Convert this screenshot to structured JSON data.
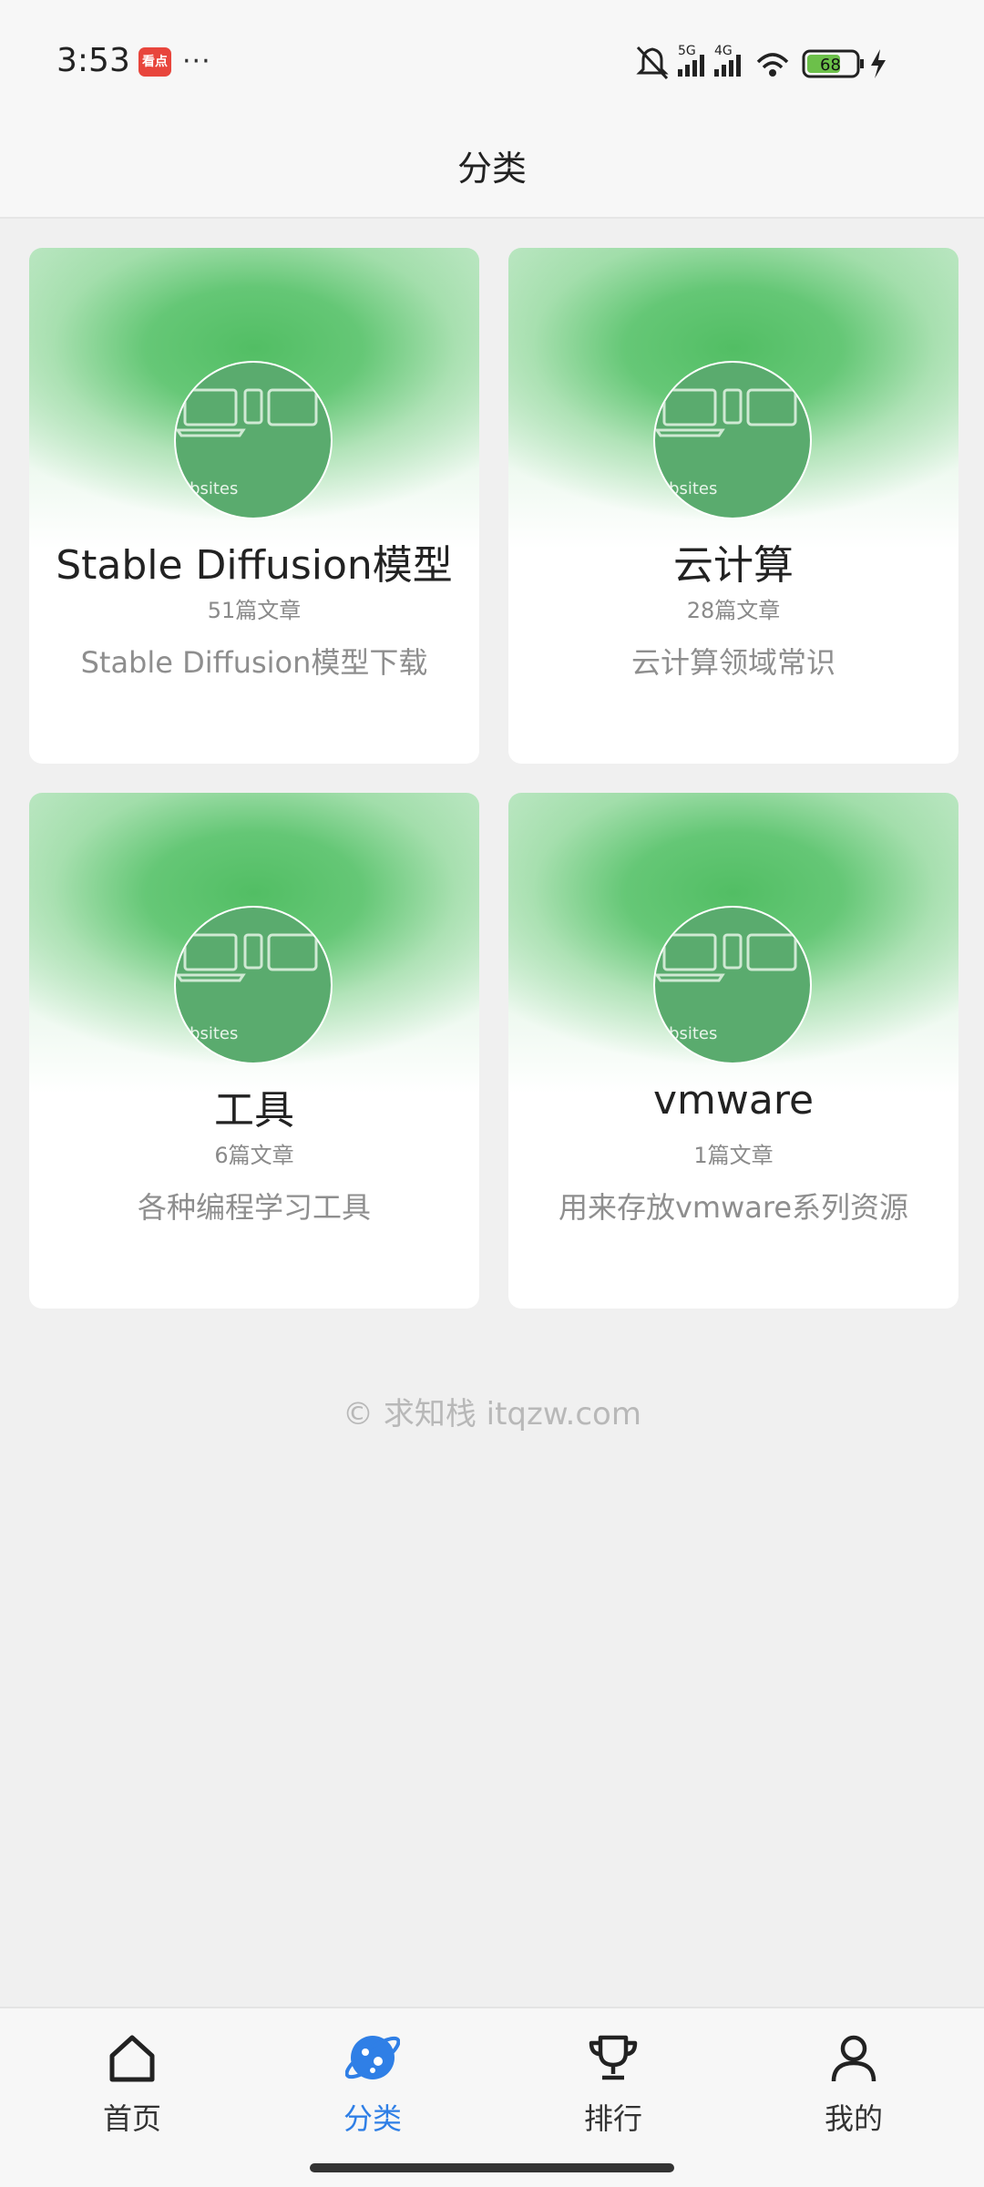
{
  "status_bar": {
    "time": "3:53",
    "notification_app": "看点",
    "more": "···",
    "battery": "68",
    "network_1": "5G",
    "network_2": "4G"
  },
  "header": {
    "title": "分类"
  },
  "categories": [
    {
      "name": "Stable Diffusion模型",
      "count": "51篇文章",
      "description": "Stable Diffusion模型下载",
      "image_caption": "ebsites"
    },
    {
      "name": "云计算",
      "count": "28篇文章",
      "description": "云计算领域常识",
      "image_caption": "ebsites"
    },
    {
      "name": "工具",
      "count": "6篇文章",
      "description": "各种编程学习工具",
      "image_caption": "ebsites"
    },
    {
      "name": "vmware",
      "count": "1篇文章",
      "description": "用来存放vmware系列资源",
      "image_caption": "ebsites"
    }
  ],
  "footer": {
    "copyright": "© 求知栈 itqzw.com"
  },
  "bottom_nav": {
    "items": [
      {
        "label": "首页",
        "icon": "home-icon",
        "active": false
      },
      {
        "label": "分类",
        "icon": "category-planet-icon",
        "active": true
      },
      {
        "label": "排行",
        "icon": "trophy-icon",
        "active": false
      },
      {
        "label": "我的",
        "icon": "user-icon",
        "active": false
      }
    ]
  },
  "colors": {
    "accent": "#2f7fe6",
    "card_green": "#52be64",
    "background": "#f0f0f0"
  }
}
